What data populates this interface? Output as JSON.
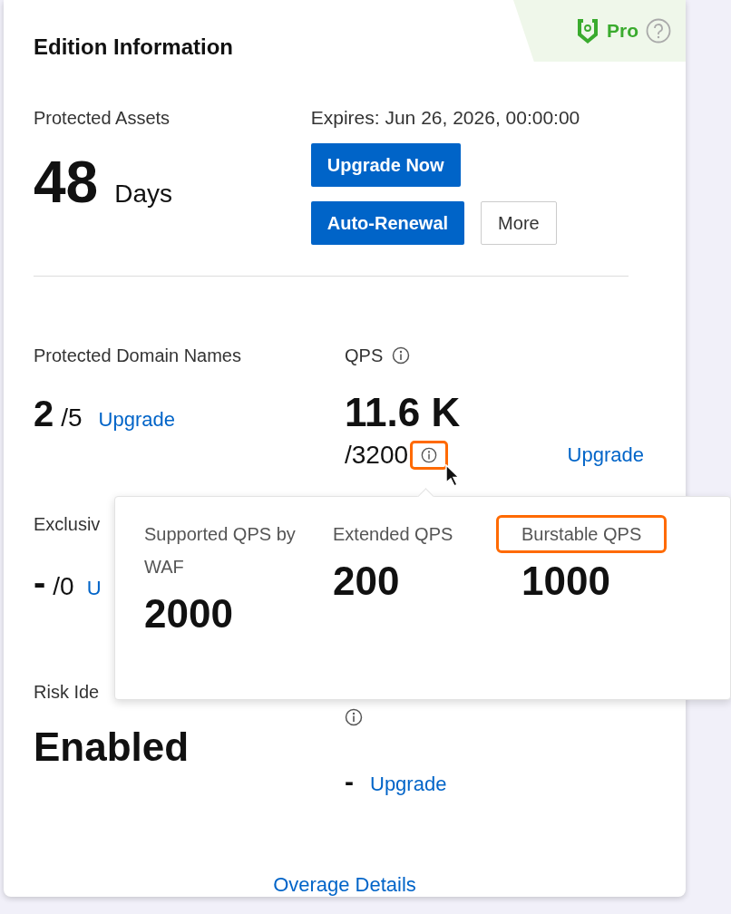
{
  "header": {
    "title": "Edition Information",
    "edition": "Pro"
  },
  "assets": {
    "label": "Protected Assets",
    "value": "48",
    "unit": "Days"
  },
  "subscription": {
    "expires": "Expires: Jun 26, 2026, 00:00:00",
    "buttons": [
      {
        "label": "Upgrade Now",
        "kind": "primary"
      },
      {
        "label": "Auto-Renewal",
        "kind": "primary"
      },
      {
        "label": "More",
        "kind": "default"
      }
    ]
  },
  "domains": {
    "label": "Protected Domain Names",
    "value": "2",
    "limit": "/5",
    "link": "Upgrade"
  },
  "qps": {
    "label": "QPS",
    "value": "11.6 K",
    "limit": "/3200",
    "link": "Upgrade",
    "info_highlighted": true
  },
  "exclusive": {
    "label": "Exclusiv",
    "value": "-",
    "limit": "/0",
    "link": "U"
  },
  "risk": {
    "label": "Risk Ide",
    "value": "Enabled"
  },
  "extra": {
    "value": "-",
    "link": "Upgrade"
  },
  "footer_link": "Overage Details",
  "popover": {
    "items": [
      {
        "label": "Supported QPS by WAF",
        "value": "2000",
        "highlighted": false
      },
      {
        "label": "Extended QPS",
        "value": "200",
        "highlighted": false
      },
      {
        "label": "Burstable QPS",
        "value": "1000",
        "highlighted": true
      }
    ]
  }
}
